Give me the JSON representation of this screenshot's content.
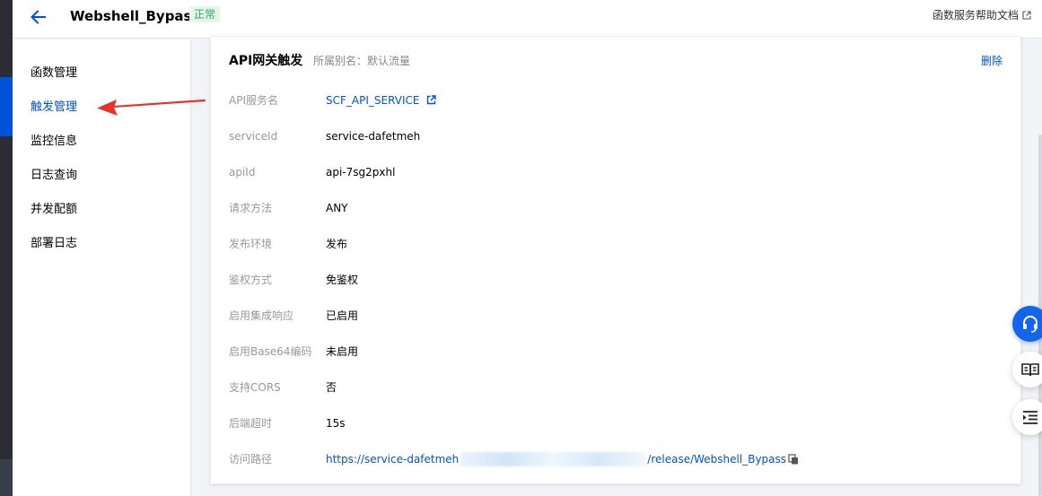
{
  "header": {
    "title": "Webshell_Bypass",
    "status": "正常",
    "help_link": "函数服务帮助文档"
  },
  "sidebar": {
    "items": [
      {
        "label": "函数管理",
        "active": false
      },
      {
        "label": "触发管理",
        "active": true
      },
      {
        "label": "监控信息",
        "active": false
      },
      {
        "label": "日志查询",
        "active": false
      },
      {
        "label": "并发配额",
        "active": false
      },
      {
        "label": "部署日志",
        "active": false
      }
    ]
  },
  "card": {
    "title": "API网关触发",
    "subtitle": "所属别名：默认流量",
    "delete_label": "删除",
    "rows": [
      {
        "label": "API服务名",
        "value": "SCF_API_SERVICE"
      },
      {
        "label": "serviceId",
        "value": "service-dafetmeh"
      },
      {
        "label": "apiId",
        "value": "api-7sg2pxhl"
      },
      {
        "label": "请求方法",
        "value": "ANY"
      },
      {
        "label": "发布环境",
        "value": "发布"
      },
      {
        "label": "鉴权方式",
        "value": "免鉴权"
      },
      {
        "label": "启用集成响应",
        "value": "已启用"
      },
      {
        "label": "启用Base64编码",
        "value": "未启用"
      },
      {
        "label": "支持CORS",
        "value": "否"
      },
      {
        "label": "后端超时",
        "value": "15s"
      },
      {
        "label": "访问路径",
        "value_prefix": "https://service-dafetmeh",
        "value_suffix": "/release/Webshell_Bypass"
      }
    ]
  },
  "colors": {
    "accent": "#0052d9",
    "status_bg": "#e3f7ea",
    "status_text": "#2ba471",
    "annotation_arrow": "#e8332b"
  },
  "icons": {
    "back": "arrow-left-icon",
    "external": "external-link-icon",
    "copy": "copy-icon",
    "support": "headset-icon",
    "docs": "book-icon",
    "menu": "list-indent-icon"
  }
}
